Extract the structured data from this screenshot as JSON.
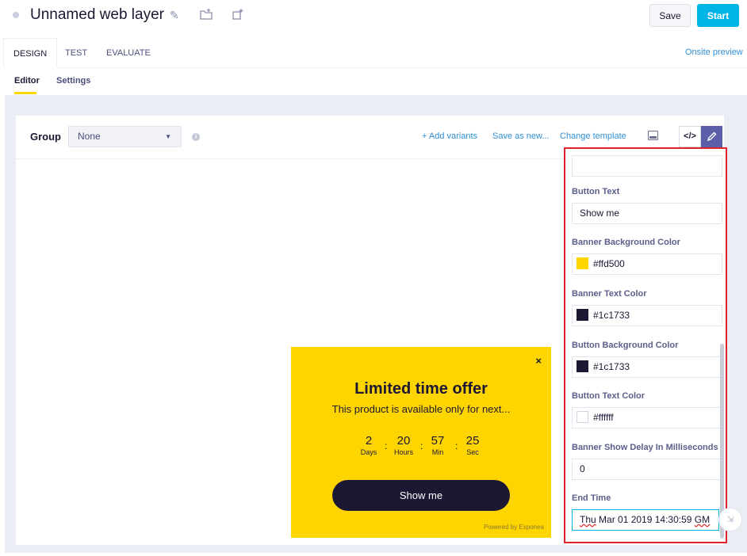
{
  "header": {
    "title": "Unnamed web layer",
    "save_label": "Save",
    "start_label": "Start"
  },
  "main_tabs": [
    {
      "label": "DESIGN"
    },
    {
      "label": "TEST"
    },
    {
      "label": "EVALUATE"
    }
  ],
  "onsite_preview": "Onsite preview",
  "sub_tabs": [
    {
      "label": "Editor"
    },
    {
      "label": "Settings"
    }
  ],
  "toolbar": {
    "group_label": "Group",
    "group_value": "None",
    "add_variants": "+ Add variants",
    "save_as_new": "Save as new...",
    "change_template": "Change template",
    "code_label": "</>"
  },
  "banner": {
    "title": "Limited time offer",
    "text": "This product is available only for next...",
    "countdown": [
      {
        "value": "2",
        "label": "Days"
      },
      {
        "value": "20",
        "label": "Hours"
      },
      {
        "value": "57",
        "label": "Min"
      },
      {
        "value": "25",
        "label": "Sec"
      }
    ],
    "separator": ":",
    "button_label": "Show me",
    "footer": "Powered by Exponea",
    "close": "×",
    "background_color": "#ffd500",
    "text_color": "#1c1733"
  },
  "settings": {
    "fields": [
      {
        "label": "Button Text",
        "value": "Show me"
      },
      {
        "label": "Banner Background Color",
        "value": "#ffd500",
        "swatch": "#ffd500"
      },
      {
        "label": "Banner Text Color",
        "value": "#1c1733",
        "swatch": "#1c1733"
      },
      {
        "label": "Button Background Color",
        "value": "#1c1733",
        "swatch": "#1c1733"
      },
      {
        "label": "Button Text Color",
        "value": "#ffffff",
        "swatch": "#ffffff"
      },
      {
        "label": "Banner Show Delay In Milliseconds",
        "value": "0"
      },
      {
        "label": "End Time",
        "value_part1": "Thu",
        "value_part2": " Mar 01 2019 14:30:59 ",
        "value_part3": "GM"
      }
    ]
  },
  "colors": {
    "accent": "#00b4e6",
    "highlight_border": "#e0232b",
    "link": "#2f8fd8"
  }
}
